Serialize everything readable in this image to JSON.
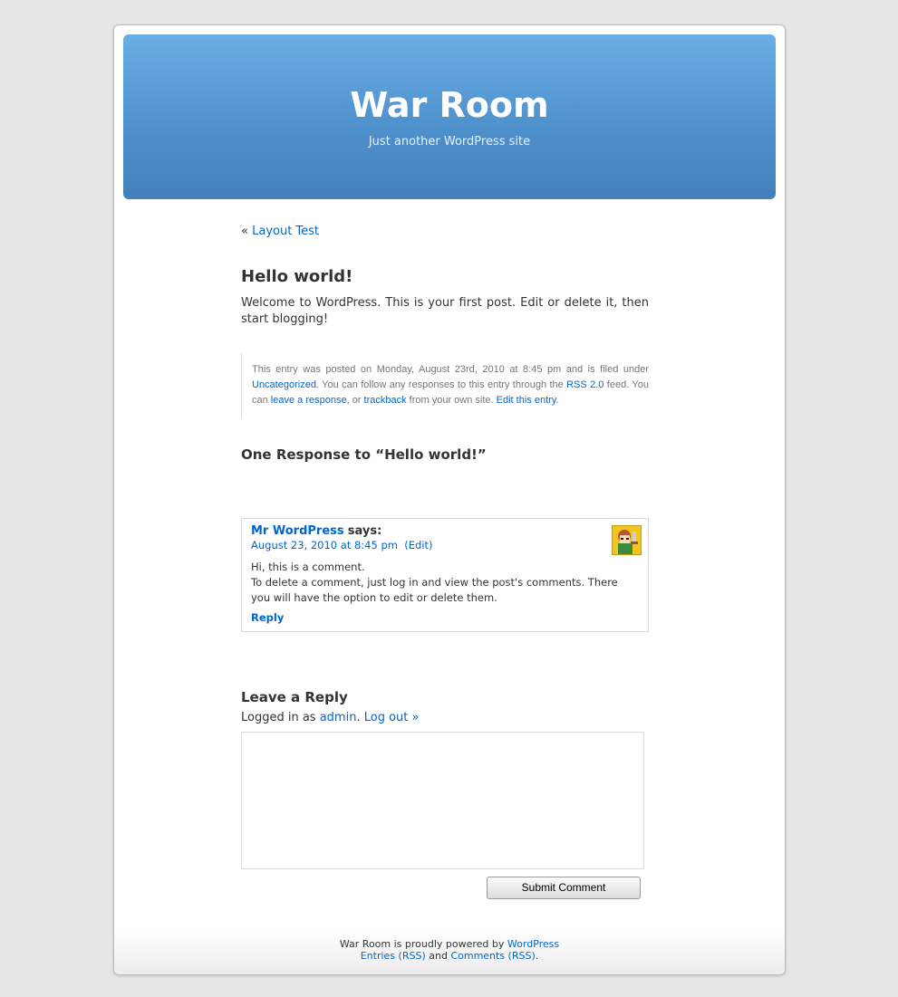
{
  "header": {
    "title": "War Room",
    "description": "Just another WordPress site"
  },
  "nav": {
    "prefix": "«",
    "prev_link": "Layout Test"
  },
  "post": {
    "title": "Hello world!",
    "body": "Welcome to WordPress. This is your first post. Edit or delete it, then start blogging!"
  },
  "postmeta": {
    "t1": "This entry was posted on Monday, August 23rd, 2010 at 8:45 pm and is filed under ",
    "category": "Uncategorized",
    "t2": ". You can follow any responses to this entry through the ",
    "rss": "RSS 2.0",
    "t3": " feed. You can ",
    "leave_response": "leave a response",
    "t4": ", or ",
    "trackback": "trackback",
    "t5": " from your own site. ",
    "edit_entry": "Edit this entry",
    "t6": "."
  },
  "responses": {
    "title": "One Response to “Hello world!”"
  },
  "comment": {
    "author": "Mr WordPress",
    "says": "says:",
    "date": "August 23, 2010 at 8:45 pm",
    "edit": "(Edit)",
    "line1": "Hi, this is a comment.",
    "line2": "To delete a comment, just log in and view the post's comments. There you will have the option to edit or delete them.",
    "reply": "Reply"
  },
  "reply_form": {
    "title": "Leave a Reply",
    "logged_prefix": "Logged in as ",
    "user": "admin",
    "dot": ".",
    "logout": "Log out »",
    "submit": "Submit Comment"
  },
  "footer": {
    "powered_prefix": "War Room is proudly powered by ",
    "wordpress": "WordPress",
    "entries_rss": "Entries (RSS)",
    "and": " and ",
    "comments_rss": "Comments (RSS)",
    "end": "."
  }
}
